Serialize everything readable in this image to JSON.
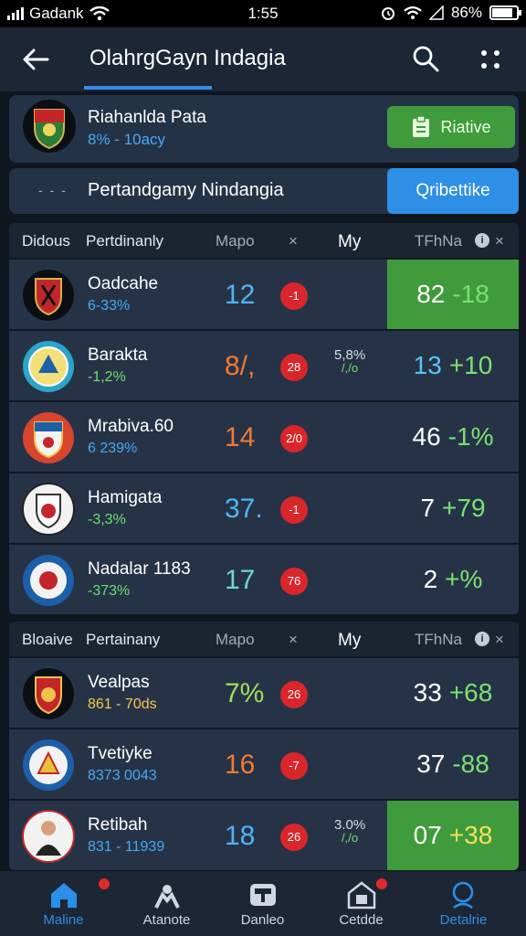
{
  "status_bar": {
    "carrier": "Gadank",
    "time": "1:55",
    "network": "4",
    "battery": "86%"
  },
  "header": {
    "title": "OlahrgGayn Indagia"
  },
  "top_card": {
    "name": "Riahanlda Pata",
    "subtitle": "8% - 10acy",
    "button_label": "Riative"
  },
  "second_card": {
    "dots": "- - -",
    "label": "Pertandgamy Nindangia",
    "button_label": "Qribettike"
  },
  "table1": {
    "headers": {
      "rank": "Didous",
      "team": "Pertdinanly",
      "mapo": "Mapo",
      "x": "×",
      "my": "My",
      "tf": "TFhNa",
      "info": "i",
      "close": "×"
    },
    "rows": [
      {
        "name": "Oadcahe",
        "sub": "6-33%",
        "score": "12",
        "badge": "-1",
        "mini_top": "",
        "mini_bot": "",
        "main": "82",
        "chg": "-18"
      },
      {
        "name": "Barakta",
        "sub": "-1,2%",
        "score": "8/,",
        "badge": "28",
        "mini_top": "5,8%",
        "mini_bot": "/,/o",
        "main": "13",
        "chg": "+10"
      },
      {
        "name": "Mrabiva.60",
        "sub": "6 239%",
        "score": "14",
        "badge": "2/0",
        "mini_top": "",
        "mini_bot": "",
        "main": "46",
        "chg": "-1%"
      },
      {
        "name": "Hamigata",
        "sub": "-3,3%",
        "score": "37.",
        "badge": "-1",
        "mini_top": "",
        "mini_bot": "",
        "main": "7",
        "chg": "+79"
      },
      {
        "name": "Nadalar 1183",
        "sub": "-373%",
        "score": "17",
        "badge": "76",
        "mini_top": "",
        "mini_bot": "",
        "main": "2",
        "chg": "+%"
      }
    ]
  },
  "table2": {
    "headers": {
      "rank": "Bloaive",
      "team": "Pertainany",
      "mapo": "Mapo",
      "x": "×",
      "my": "My",
      "tf": "TFhNa",
      "info": "i",
      "close": "×"
    },
    "rows": [
      {
        "name": "Vealpas",
        "sub": "861 - 70ds",
        "score": "7%",
        "badge": "26",
        "mini_top": "",
        "mini_bot": "",
        "main": "33",
        "chg": "+68"
      },
      {
        "name": "Tvetiyke",
        "sub": "8373 0043",
        "score": "16",
        "badge": "-7",
        "mini_top": "",
        "mini_bot": "",
        "main": "37",
        "chg": "-88"
      },
      {
        "name": "Retibah",
        "sub": "831 - 11939",
        "score": "18",
        "badge": "26",
        "mini_top": "3.0%",
        "mini_bot": "/,/o",
        "main": "07",
        "chg": "+38"
      }
    ]
  },
  "bottom_nav": [
    {
      "label": "Maline",
      "icon": "home-icon",
      "active": true,
      "dot": true
    },
    {
      "label": "Atanote",
      "icon": "players-icon",
      "active": false,
      "dot": false
    },
    {
      "label": "Danleo",
      "icon": "tv-icon",
      "active": false,
      "dot": false
    },
    {
      "label": "Cetdde",
      "icon": "stadium-icon",
      "active": false,
      "dot": true
    },
    {
      "label": "Detalrie",
      "icon": "search-icon",
      "active": true,
      "dot": false
    }
  ],
  "colors": {
    "accent_blue": "#2d8fe6",
    "accent_green": "#3f9b3b",
    "badge_red": "#d9262b"
  }
}
